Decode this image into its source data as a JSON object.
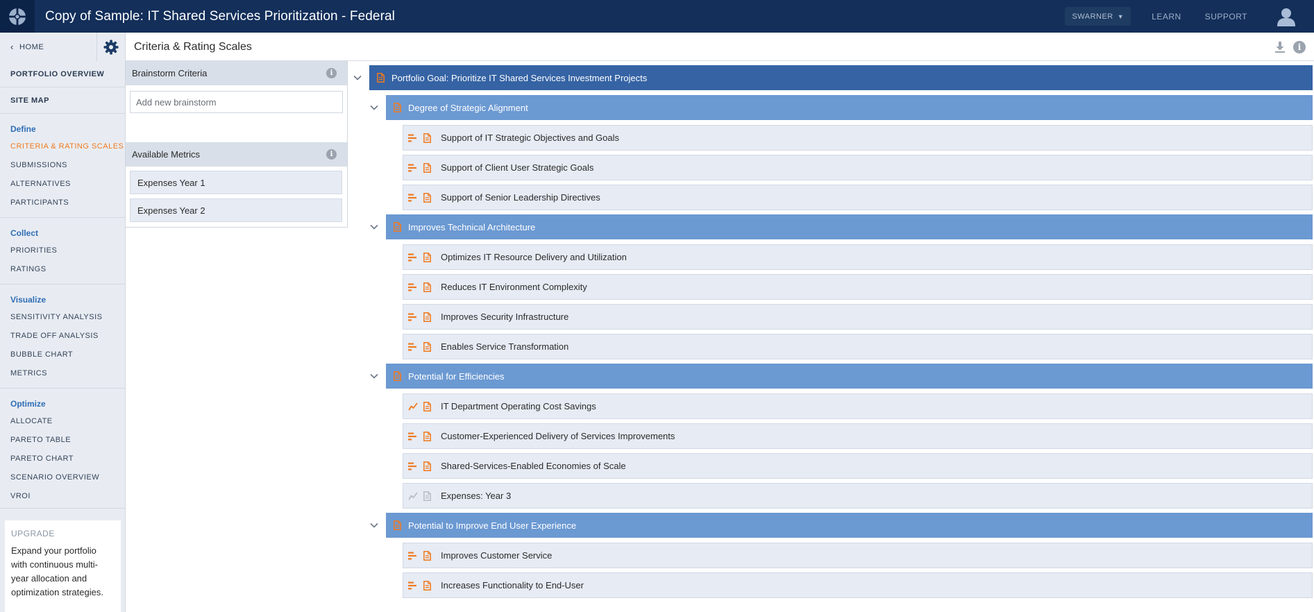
{
  "app": {
    "title": "Copy of Sample: IT Shared Services Prioritization - Federal",
    "user_menu": "SWARNER",
    "links": {
      "learn": "LEARN",
      "support": "SUPPORT"
    }
  },
  "subheader": {
    "home": "HOME",
    "page_title": "Criteria & Rating Scales"
  },
  "sidebar": {
    "portfolio_overview": "PORTFOLIO OVERVIEW",
    "site_map": "SITE MAP",
    "groups": [
      {
        "heading": "Define",
        "items": [
          "CRITERIA & RATING SCALES",
          "SUBMISSIONS",
          "ALTERNATIVES",
          "PARTICIPANTS"
        ]
      },
      {
        "heading": "Collect",
        "items": [
          "PRIORITIES",
          "RATINGS"
        ]
      },
      {
        "heading": "Visualize",
        "items": [
          "SENSITIVITY ANALYSIS",
          "TRADE OFF ANALYSIS",
          "BUBBLE CHART",
          "METRICS"
        ]
      },
      {
        "heading": "Optimize",
        "items": [
          "ALLOCATE",
          "PARETO TABLE",
          "PARETO CHART",
          "SCENARIO OVERVIEW",
          "VROI"
        ]
      }
    ],
    "active_item": "CRITERIA & RATING SCALES",
    "upgrade": {
      "title": "UPGRADE",
      "text": "Expand your portfolio with continuous multi-year allocation and optimization strategies."
    }
  },
  "brainstorm": {
    "title": "Brainstorm Criteria",
    "input_placeholder": "Add new brainstorm"
  },
  "metrics": {
    "title": "Available Metrics",
    "items": [
      "Expenses Year 1",
      "Expenses Year 2"
    ]
  },
  "tree": {
    "goal": "Portfolio Goal: Prioritize IT Shared Services Investment Projects",
    "categories": [
      {
        "label": "Degree of Strategic Alignment",
        "children": [
          {
            "label": "Support of IT Strategic Objectives and Goals",
            "scale_icon": "rating-scale-icon"
          },
          {
            "label": "Support of Client User Strategic Goals",
            "scale_icon": "rating-scale-icon"
          },
          {
            "label": "Support of Senior Leadership Directives",
            "scale_icon": "rating-scale-icon"
          }
        ]
      },
      {
        "label": "Improves Technical Architecture",
        "children": [
          {
            "label": "Optimizes IT Resource Delivery and Utilization",
            "scale_icon": "rating-scale-icon"
          },
          {
            "label": "Reduces IT Environment Complexity",
            "scale_icon": "rating-scale-icon"
          },
          {
            "label": "Improves Security Infrastructure",
            "scale_icon": "rating-scale-icon"
          },
          {
            "label": "Enables Service Transformation",
            "scale_icon": "rating-scale-icon"
          }
        ]
      },
      {
        "label": "Potential for Efficiencies",
        "children": [
          {
            "label": "IT Department Operating Cost Savings",
            "scale_icon": "trend-line-icon"
          },
          {
            "label": "Customer-Experienced Delivery of Services Improvements",
            "scale_icon": "rating-scale-icon"
          },
          {
            "label": "Shared-Services-Enabled Economies of Scale",
            "scale_icon": "rating-scale-icon"
          },
          {
            "label": "Expenses: Year 3",
            "scale_icon": "trend-line-icon-muted"
          }
        ]
      },
      {
        "label": "Potential to Improve End User Experience",
        "children": [
          {
            "label": "Improves Customer Service",
            "scale_icon": "rating-scale-icon"
          },
          {
            "label": "Increases Functionality to End-User",
            "scale_icon": "rating-scale-icon"
          }
        ]
      }
    ]
  },
  "colors": {
    "topbar": "#132f5a",
    "goal_row": "#3563a4",
    "category_row": "#6b99d2",
    "leaf_row": "#e6ebf4",
    "accent_orange": "#f07a1f",
    "nav_heading_blue": "#2f6db5"
  }
}
